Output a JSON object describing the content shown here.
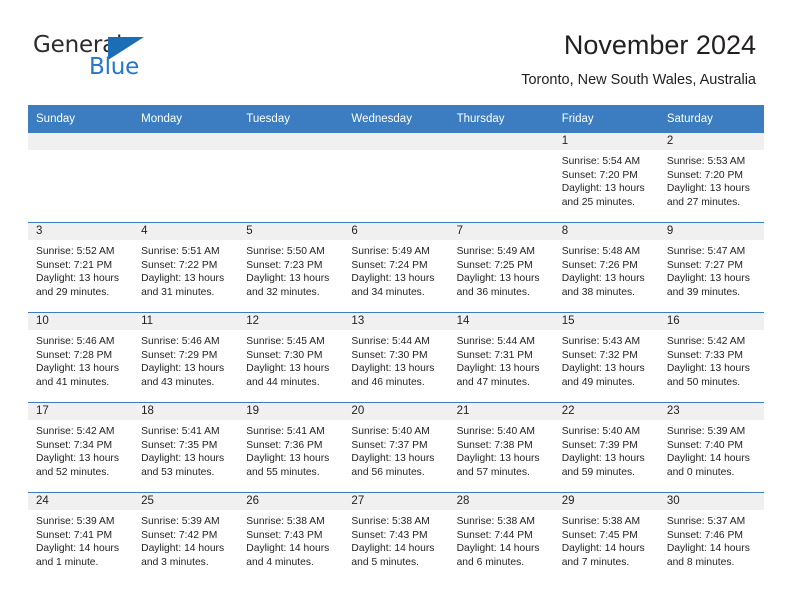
{
  "brand": {
    "name_part1": "General",
    "name_part2": "Blue",
    "mark": "triangle-logo"
  },
  "header": {
    "title": "November 2024",
    "subtitle": "Toronto, New South Wales, Australia"
  },
  "colors": {
    "header_blue": "#3b7dc0",
    "row_divider": "#3b7dc0",
    "daynum_strip": "#f0f0f0",
    "brand_blue": "#2277c8",
    "text": "#231f20"
  },
  "weekday_headers": [
    "Sunday",
    "Monday",
    "Tuesday",
    "Wednesday",
    "Thursday",
    "Friday",
    "Saturday"
  ],
  "labels": {
    "sunrise_prefix": "Sunrise:",
    "sunset_prefix": "Sunset:",
    "daylight_prefix": "Daylight:"
  },
  "weeks": [
    [
      {
        "day": "",
        "lines": []
      },
      {
        "day": "",
        "lines": []
      },
      {
        "day": "",
        "lines": []
      },
      {
        "day": "",
        "lines": []
      },
      {
        "day": "",
        "lines": []
      },
      {
        "day": "1",
        "lines": [
          "Sunrise: 5:54 AM",
          "Sunset: 7:20 PM",
          "Daylight: 13 hours and 25 minutes."
        ]
      },
      {
        "day": "2",
        "lines": [
          "Sunrise: 5:53 AM",
          "Sunset: 7:20 PM",
          "Daylight: 13 hours and 27 minutes."
        ]
      }
    ],
    [
      {
        "day": "3",
        "lines": [
          "Sunrise: 5:52 AM",
          "Sunset: 7:21 PM",
          "Daylight: 13 hours and 29 minutes."
        ]
      },
      {
        "day": "4",
        "lines": [
          "Sunrise: 5:51 AM",
          "Sunset: 7:22 PM",
          "Daylight: 13 hours and 31 minutes."
        ]
      },
      {
        "day": "5",
        "lines": [
          "Sunrise: 5:50 AM",
          "Sunset: 7:23 PM",
          "Daylight: 13 hours and 32 minutes."
        ]
      },
      {
        "day": "6",
        "lines": [
          "Sunrise: 5:49 AM",
          "Sunset: 7:24 PM",
          "Daylight: 13 hours and 34 minutes."
        ]
      },
      {
        "day": "7",
        "lines": [
          "Sunrise: 5:49 AM",
          "Sunset: 7:25 PM",
          "Daylight: 13 hours and 36 minutes."
        ]
      },
      {
        "day": "8",
        "lines": [
          "Sunrise: 5:48 AM",
          "Sunset: 7:26 PM",
          "Daylight: 13 hours and 38 minutes."
        ]
      },
      {
        "day": "9",
        "lines": [
          "Sunrise: 5:47 AM",
          "Sunset: 7:27 PM",
          "Daylight: 13 hours and 39 minutes."
        ]
      }
    ],
    [
      {
        "day": "10",
        "lines": [
          "Sunrise: 5:46 AM",
          "Sunset: 7:28 PM",
          "Daylight: 13 hours and 41 minutes."
        ]
      },
      {
        "day": "11",
        "lines": [
          "Sunrise: 5:46 AM",
          "Sunset: 7:29 PM",
          "Daylight: 13 hours and 43 minutes."
        ]
      },
      {
        "day": "12",
        "lines": [
          "Sunrise: 5:45 AM",
          "Sunset: 7:30 PM",
          "Daylight: 13 hours and 44 minutes."
        ]
      },
      {
        "day": "13",
        "lines": [
          "Sunrise: 5:44 AM",
          "Sunset: 7:30 PM",
          "Daylight: 13 hours and 46 minutes."
        ]
      },
      {
        "day": "14",
        "lines": [
          "Sunrise: 5:44 AM",
          "Sunset: 7:31 PM",
          "Daylight: 13 hours and 47 minutes."
        ]
      },
      {
        "day": "15",
        "lines": [
          "Sunrise: 5:43 AM",
          "Sunset: 7:32 PM",
          "Daylight: 13 hours and 49 minutes."
        ]
      },
      {
        "day": "16",
        "lines": [
          "Sunrise: 5:42 AM",
          "Sunset: 7:33 PM",
          "Daylight: 13 hours and 50 minutes."
        ]
      }
    ],
    [
      {
        "day": "17",
        "lines": [
          "Sunrise: 5:42 AM",
          "Sunset: 7:34 PM",
          "Daylight: 13 hours and 52 minutes."
        ]
      },
      {
        "day": "18",
        "lines": [
          "Sunrise: 5:41 AM",
          "Sunset: 7:35 PM",
          "Daylight: 13 hours and 53 minutes."
        ]
      },
      {
        "day": "19",
        "lines": [
          "Sunrise: 5:41 AM",
          "Sunset: 7:36 PM",
          "Daylight: 13 hours and 55 minutes."
        ]
      },
      {
        "day": "20",
        "lines": [
          "Sunrise: 5:40 AM",
          "Sunset: 7:37 PM",
          "Daylight: 13 hours and 56 minutes."
        ]
      },
      {
        "day": "21",
        "lines": [
          "Sunrise: 5:40 AM",
          "Sunset: 7:38 PM",
          "Daylight: 13 hours and 57 minutes."
        ]
      },
      {
        "day": "22",
        "lines": [
          "Sunrise: 5:40 AM",
          "Sunset: 7:39 PM",
          "Daylight: 13 hours and 59 minutes."
        ]
      },
      {
        "day": "23",
        "lines": [
          "Sunrise: 5:39 AM",
          "Sunset: 7:40 PM",
          "Daylight: 14 hours and 0 minutes."
        ]
      }
    ],
    [
      {
        "day": "24",
        "lines": [
          "Sunrise: 5:39 AM",
          "Sunset: 7:41 PM",
          "Daylight: 14 hours and 1 minute."
        ]
      },
      {
        "day": "25",
        "lines": [
          "Sunrise: 5:39 AM",
          "Sunset: 7:42 PM",
          "Daylight: 14 hours and 3 minutes."
        ]
      },
      {
        "day": "26",
        "lines": [
          "Sunrise: 5:38 AM",
          "Sunset: 7:43 PM",
          "Daylight: 14 hours and 4 minutes."
        ]
      },
      {
        "day": "27",
        "lines": [
          "Sunrise: 5:38 AM",
          "Sunset: 7:43 PM",
          "Daylight: 14 hours and 5 minutes."
        ]
      },
      {
        "day": "28",
        "lines": [
          "Sunrise: 5:38 AM",
          "Sunset: 7:44 PM",
          "Daylight: 14 hours and 6 minutes."
        ]
      },
      {
        "day": "29",
        "lines": [
          "Sunrise: 5:38 AM",
          "Sunset: 7:45 PM",
          "Daylight: 14 hours and 7 minutes."
        ]
      },
      {
        "day": "30",
        "lines": [
          "Sunrise: 5:37 AM",
          "Sunset: 7:46 PM",
          "Daylight: 14 hours and 8 minutes."
        ]
      }
    ]
  ]
}
